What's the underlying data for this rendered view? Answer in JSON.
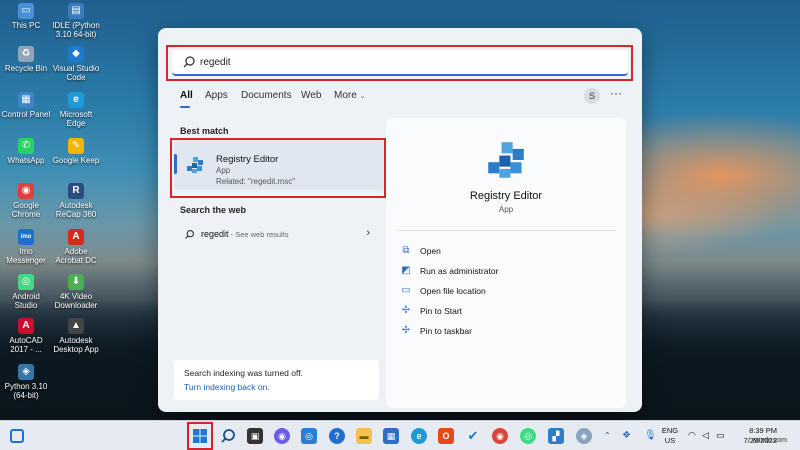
{
  "desktop": {
    "icons": [
      {
        "label": "This PC",
        "glyph": "▭",
        "color": "#4a90d9"
      },
      {
        "label": "IDLE (Python 3.10 64-bit)",
        "glyph": "▤",
        "color": "#3b7bbf"
      },
      {
        "label": "Recycle Bin",
        "glyph": "♻",
        "color": "#8fa6b8"
      },
      {
        "label": "Visual Studio Code",
        "glyph": "◆",
        "color": "#1f7ad1"
      },
      {
        "label": "Control Panel",
        "glyph": "▦",
        "color": "#3d86c6"
      },
      {
        "label": "Microsoft Edge",
        "glyph": "e",
        "color": "#1e9ad6"
      },
      {
        "label": "WhatsApp",
        "glyph": "✆",
        "color": "#25d366"
      },
      {
        "label": "Google Keep",
        "glyph": "✎",
        "color": "#f4b400"
      },
      {
        "label": "Google Chrome",
        "glyph": "◉",
        "color": "#db4437"
      },
      {
        "label": "Autodesk ReCap 360",
        "glyph": "R",
        "color": "#2b4c7e"
      },
      {
        "label": "Imo Messenger",
        "glyph": "imo",
        "color": "#1f6fd1"
      },
      {
        "label": "Adobe Acrobat DC",
        "glyph": "A",
        "color": "#d52b1e"
      },
      {
        "label": "Android Studio",
        "glyph": "◎",
        "color": "#3ddc84"
      },
      {
        "label": "4K Video Downloader",
        "glyph": "⬇",
        "color": "#4caf50"
      },
      {
        "label": "AutoCAD 2017 - ...",
        "glyph": "A",
        "color": "#c8102e"
      },
      {
        "label": "Autodesk Desktop App",
        "glyph": "▲",
        "color": "#444444"
      },
      {
        "label": "Python 3.10 (64-bit)",
        "glyph": "◈",
        "color": "#3776ab"
      }
    ]
  },
  "search": {
    "query": "regedit",
    "tabs": [
      "All",
      "Apps",
      "Documents",
      "Web",
      "More"
    ],
    "avatar_initial": "S",
    "more_dots": "···",
    "best_match_title": "Best match",
    "best_match": {
      "name": "Registry Editor",
      "type": "App",
      "related": "Related: \"regedit.msc\""
    },
    "web_title": "Search the web",
    "web_query": "regedit",
    "web_hint": " - See web results",
    "index_notice": "Search indexing was turned off.",
    "index_link": "Turn indexing back on.",
    "detail": {
      "name": "Registry Editor",
      "type": "App",
      "actions": [
        "Open",
        "Run as administrator",
        "Open file location",
        "Pin to Start",
        "Pin to taskbar"
      ]
    }
  },
  "taskbar": {
    "language": "ENG",
    "region": "US",
    "time": "8:39 PM",
    "date": "7/29/2022",
    "watermark": "wsxdn.com"
  },
  "colors": {
    "accent": "#2d6dc3",
    "highlight": "#d7262b"
  }
}
